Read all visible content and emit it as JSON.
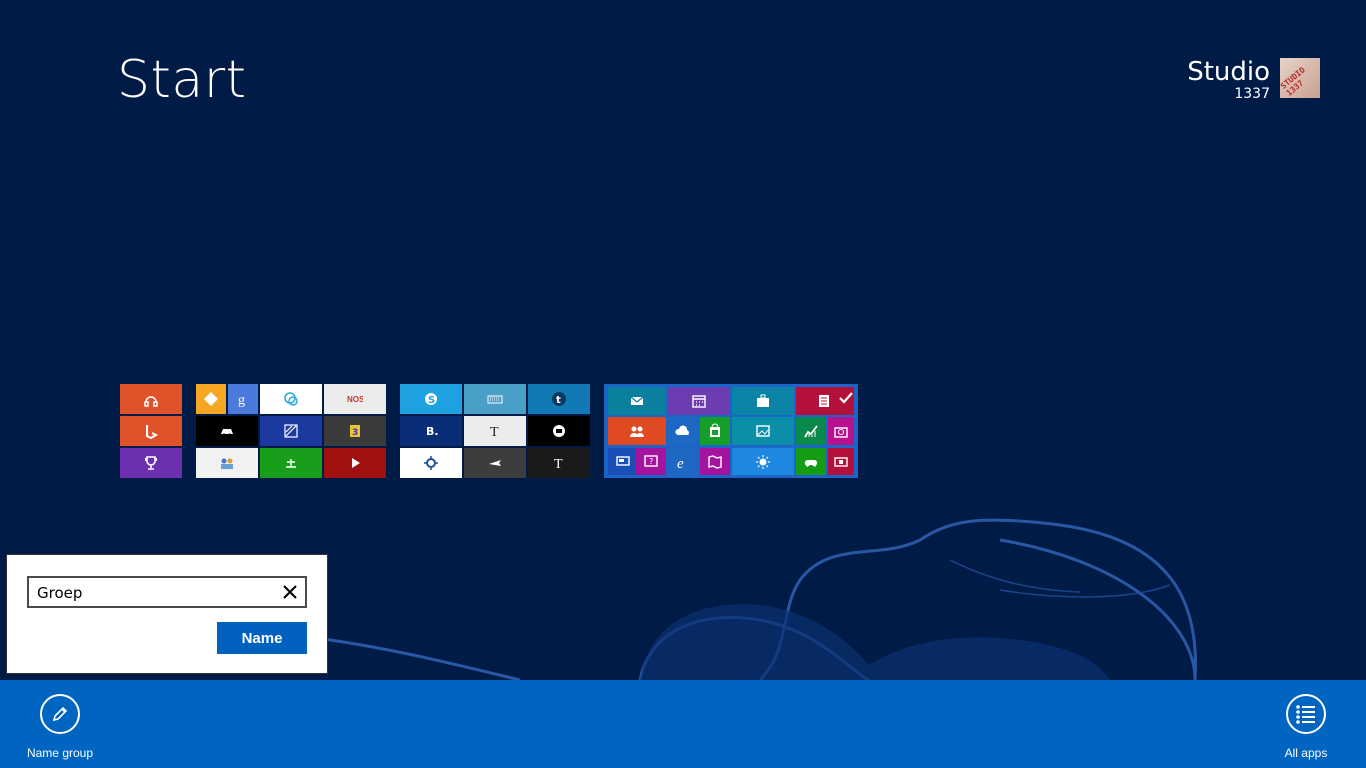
{
  "start": {
    "title": "Start"
  },
  "user": {
    "name": "Studio",
    "subtitle": "1337",
    "avatar_text": "STUDIO 1337"
  },
  "tiles": [
    {
      "name": "music-tile",
      "icon": "headphones-icon",
      "color": "#e0522a"
    },
    {
      "name": "bing-tile",
      "icon": "bing-icon",
      "color": "#e0522a"
    },
    {
      "name": "games-achievement-tile",
      "icon": "trophy-icon",
      "color": "#6c2fb0"
    },
    {
      "name": "diamond-app-tile",
      "icon": "diamond-icon",
      "color": "#f5a623"
    },
    {
      "name": "google-tile",
      "icon": "google-icon",
      "color": "#4a7bdc"
    },
    {
      "name": "circles-app-tile",
      "icon": "circles-icon",
      "color": "#ffffff"
    },
    {
      "name": "nos-tile",
      "text": "NOS",
      "icon": "nos-icon",
      "color": "#ececec"
    },
    {
      "name": "dark-app-tile",
      "icon": "car-icon",
      "color": "#000000"
    },
    {
      "name": "stripe-app-tile",
      "icon": "stripe-icon",
      "color": "#1b3aa0"
    },
    {
      "name": "comic-app-tile",
      "icon": "comic-icon",
      "color": "#3b3b3b"
    },
    {
      "name": "people-photo-tile",
      "icon": "people-photo-icon",
      "color": "#f2f2f2"
    },
    {
      "name": "green-app-tile",
      "icon": "scale-icon",
      "color": "#199e1b"
    },
    {
      "name": "video-tile",
      "icon": "play-icon",
      "color": "#a0110f"
    },
    {
      "name": "skype-tile",
      "icon": "skype-icon",
      "color": "#1ea1e0"
    },
    {
      "name": "keyboard-tile",
      "icon": "keyboard-icon",
      "color": "#4a9fc8"
    },
    {
      "name": "tumblr-tile",
      "icon": "tumblr-icon",
      "color": "#117ab4"
    },
    {
      "name": "booking-tile",
      "text": "B.",
      "icon": "booking-icon",
      "color": "#0a2d78"
    },
    {
      "name": "nytimes-tile",
      "icon": "nyt-icon",
      "color": "#ececec"
    },
    {
      "name": "black-circle-tile",
      "icon": "record-icon",
      "color": "#000000"
    },
    {
      "name": "sun-app-tile",
      "icon": "sun-icon",
      "color": "#ffffff"
    },
    {
      "name": "flight-tile",
      "icon": "plane-icon",
      "color": "#3d3d3d"
    },
    {
      "name": "nytimes-dark-tile",
      "icon": "nyt-icon",
      "color": "#1a1a1a"
    },
    {
      "name": "mail-tile",
      "icon": "mail-icon",
      "color": "#0b7f9e"
    },
    {
      "name": "calendar-tile",
      "icon": "calendar-icon",
      "color": "#6b3db0"
    },
    {
      "name": "travel-tile",
      "icon": "suitcase-icon",
      "color": "#0b84a8"
    },
    {
      "name": "news-tile",
      "icon": "newspaper-icon",
      "color": "#b3113c"
    },
    {
      "name": "people-tile",
      "icon": "people-icon",
      "color": "#e04a23"
    },
    {
      "name": "onedrive-tile",
      "icon": "cloud-icon",
      "color": "#1e68c4"
    },
    {
      "name": "store-tile",
      "icon": "store-icon",
      "color": "#159e2a"
    },
    {
      "name": "photos-tile",
      "icon": "photo-icon",
      "color": "#0b8fa8"
    },
    {
      "name": "finance-tile",
      "icon": "chart-icon",
      "color": "#0a8a4a"
    },
    {
      "name": "camera-tile",
      "icon": "camera-icon",
      "color": "#b8118e"
    },
    {
      "name": "desktop-tile",
      "icon": "desktop-icon",
      "color": "#1a4fb8"
    },
    {
      "name": "help-tile",
      "icon": "help-icon",
      "color": "#a3139e"
    },
    {
      "name": "internet-explorer-tile",
      "icon": "ie-icon",
      "color": "#1e68c4"
    },
    {
      "name": "maps-tile",
      "icon": "map-icon",
      "color": "#a3139e"
    },
    {
      "name": "weather-tile",
      "icon": "weather-icon",
      "color": "#1e88e0"
    },
    {
      "name": "xbox-games-tile",
      "icon": "gamepad-icon",
      "color": "#149c14"
    },
    {
      "name": "video-app-tile",
      "icon": "video-icon",
      "color": "#b3113c"
    }
  ],
  "flyout": {
    "input_value": "Groep",
    "button_label": "Name",
    "clear_icon": "close-icon"
  },
  "appbar": {
    "name_group_label": "Name group",
    "name_group_icon": "pencil-icon",
    "all_apps_label": "All apps",
    "all_apps_icon": "list-icon"
  },
  "colors": {
    "background": "#011b47",
    "appbar": "#0065c0",
    "accent": "#0062be"
  }
}
